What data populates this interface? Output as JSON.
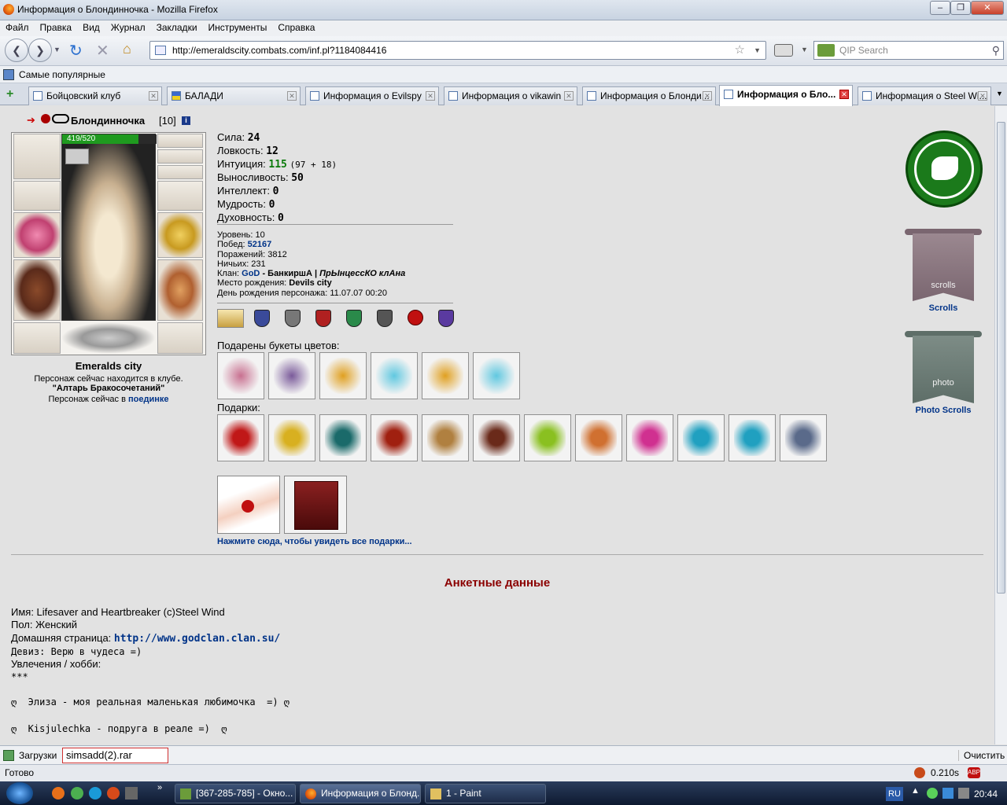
{
  "window": {
    "title": "Информация о Блондинночка - Mozilla Firefox"
  },
  "menu": [
    "Файл",
    "Правка",
    "Вид",
    "Журнал",
    "Закладки",
    "Инструменты",
    "Справка"
  ],
  "nav": {
    "url": "http://emeraldscity.combats.com/inf.pl?1184084416",
    "search_placeholder": "QIP Search"
  },
  "bookmarks": {
    "popular": "Самые популярные"
  },
  "tabs": [
    "Бойцовский клуб",
    "БАЛАДИ",
    "Информация о Evilspy",
    "Информация о vikawin",
    "Информация о Блонди...",
    "Информация о Бло...",
    "Информация о Steel Wi..."
  ],
  "char": {
    "name": "Блондинночка",
    "level_tag": "[10]",
    "hp": "419/520",
    "city": "Emeralds city",
    "loc1": "Персонаж сейчас находится в клубе.",
    "loc2": "\"Алтарь Бракосочетаний\"",
    "loc3": "Персонаж сейчас в",
    "loc3_link": "поединке"
  },
  "stats": [
    {
      "label": "Сила:",
      "value": "24",
      "extra": ""
    },
    {
      "label": "Ловкость:",
      "value": "12",
      "extra": ""
    },
    {
      "label": "Интуиция:",
      "value": "115",
      "extra": "(97 + 18)"
    },
    {
      "label": "Выносливость:",
      "value": "50",
      "extra": ""
    },
    {
      "label": "Интеллект:",
      "value": "0",
      "extra": ""
    },
    {
      "label": "Мудрость:",
      "value": "0",
      "extra": ""
    },
    {
      "label": "Духовность:",
      "value": "0",
      "extra": ""
    }
  ],
  "info": {
    "level": "Уровень: 10",
    "wins_label": "Побед:",
    "wins": "52167",
    "losses": "Поражений: 3812",
    "draws": "Ничьих: 231",
    "clan_label": "Клан:",
    "clan": "GoD",
    "clan_rank": "- БанкиршА |",
    "clan_title": "ПрЫнцессКО клАна",
    "birthplace_label": "Место рождения:",
    "birthplace": "Devils city",
    "birthday": "День рождения персонажа: 11.07.07 00:20"
  },
  "flowers_title": "Подарены букеты цветов:",
  "gifts_title": "Подарки:",
  "gifts_link": "Нажмите сюда, чтобы увидеть все подарки...",
  "right": {
    "scrolls": "Scrolls",
    "photo": "Photo Scrolls",
    "scroll_inner": "scrolls",
    "photo_inner": "photo"
  },
  "anketa": {
    "title": "Анкетные данные",
    "name": "Имя: Lifesaver and Heartbreaker (c)Steel Wind",
    "sex": "Пол: Женский",
    "home_label": "Домашняя страница:",
    "home": "http://www.godclan.clan.su/",
    "motto": "Девиз: Верю в чудеса =)",
    "hobby": "Увлечения / хобби:",
    "stars": "***",
    "line1": "ღ  Элиза - моя реальная маленькая любимочка  =) ღ",
    "line2": "ღ  Kisjulechka - подруга в реале =)  ღ"
  },
  "downloads": {
    "label": "Загрузки",
    "file": "simsadd(2).rar",
    "clear": "Очистить"
  },
  "status": {
    "text": "Готово",
    "time": "0.210s"
  },
  "taskbar": {
    "items": [
      "[367-285-785] - Окно...",
      "Информация о Блонд...",
      "1 - Paint"
    ],
    "lang": "RU",
    "clock": "20:44"
  },
  "colors": {
    "link": "#003388",
    "anketa_title": "#8b0000",
    "goat": "#1b7a1b"
  }
}
